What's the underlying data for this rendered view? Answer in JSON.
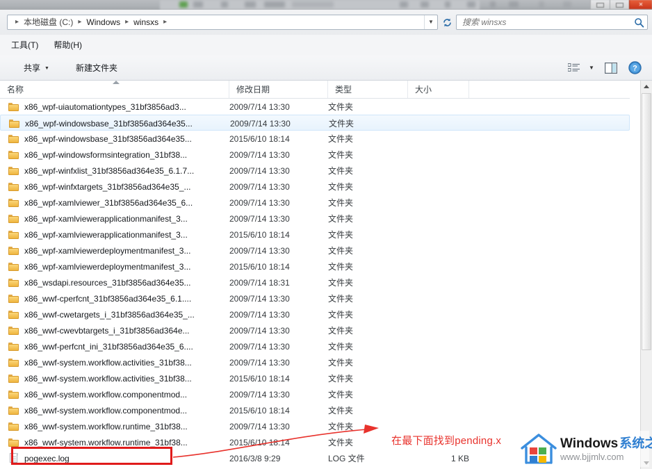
{
  "window": {
    "controls": [
      {
        "name": "minimize",
        "glyph": ""
      },
      {
        "name": "maximize",
        "glyph": ""
      },
      {
        "name": "close",
        "glyph": "✕"
      }
    ]
  },
  "address_bar": {
    "breadcrumbs": [
      "本地磁盘 (C:)",
      "Windows",
      "winsxs"
    ],
    "separator": "▸",
    "dropdown_caret": "▼",
    "refresh_label": "↻",
    "refresh_icon": "refresh-icon"
  },
  "search": {
    "placeholder": "搜索 winsxs",
    "value": "",
    "icon": "search-icon"
  },
  "menu_bar": {
    "items": [
      {
        "label": "工具(T)"
      },
      {
        "label": "帮助(H)"
      }
    ]
  },
  "command_bar": {
    "share_label": "共享",
    "share_caret": "▼",
    "new_folder_label": "新建文件夹",
    "view_icon": "view-mode-icon",
    "view_caret": "▼",
    "preview_icon": "preview-pane-icon",
    "help_icon": "help-icon",
    "help_glyph": "?"
  },
  "columns": [
    {
      "key": "name",
      "label": "名称"
    },
    {
      "key": "date",
      "label": "修改日期"
    },
    {
      "key": "type",
      "label": "类型"
    },
    {
      "key": "size",
      "label": "大小"
    }
  ],
  "sort": {
    "column": "名称",
    "direction": "asc"
  },
  "files": [
    {
      "name": "x86_wpf-uiautomationtypes_31bf3856ad3...",
      "date": "2009/7/14 13:30",
      "type": "文件夹",
      "size": "",
      "icon": "folder-icon",
      "state": "normal"
    },
    {
      "name": "x86_wpf-windowsbase_31bf3856ad364e35...",
      "date": "2009/7/14 13:30",
      "type": "文件夹",
      "size": "",
      "icon": "folder-icon",
      "state": "hover"
    },
    {
      "name": "x86_wpf-windowsbase_31bf3856ad364e35...",
      "date": "2015/6/10 18:14",
      "type": "文件夹",
      "size": "",
      "icon": "folder-icon",
      "state": "normal"
    },
    {
      "name": "x86_wpf-windowsformsintegration_31bf38...",
      "date": "2009/7/14 13:30",
      "type": "文件夹",
      "size": "",
      "icon": "folder-icon",
      "state": "normal"
    },
    {
      "name": "x86_wpf-winfxlist_31bf3856ad364e35_6.1.7...",
      "date": "2009/7/14 13:30",
      "type": "文件夹",
      "size": "",
      "icon": "folder-icon",
      "state": "normal"
    },
    {
      "name": "x86_wpf-winfxtargets_31bf3856ad364e35_...",
      "date": "2009/7/14 13:30",
      "type": "文件夹",
      "size": "",
      "icon": "folder-icon",
      "state": "normal"
    },
    {
      "name": "x86_wpf-xamlviewer_31bf3856ad364e35_6...",
      "date": "2009/7/14 13:30",
      "type": "文件夹",
      "size": "",
      "icon": "folder-icon",
      "state": "normal"
    },
    {
      "name": "x86_wpf-xamlviewerapplicationmanifest_3...",
      "date": "2009/7/14 13:30",
      "type": "文件夹",
      "size": "",
      "icon": "folder-icon",
      "state": "normal"
    },
    {
      "name": "x86_wpf-xamlviewerapplicationmanifest_3...",
      "date": "2015/6/10 18:14",
      "type": "文件夹",
      "size": "",
      "icon": "folder-icon",
      "state": "normal"
    },
    {
      "name": "x86_wpf-xamlviewerdeploymentmanifest_3...",
      "date": "2009/7/14 13:30",
      "type": "文件夹",
      "size": "",
      "icon": "folder-icon",
      "state": "normal"
    },
    {
      "name": "x86_wpf-xamlviewerdeploymentmanifest_3...",
      "date": "2015/6/10 18:14",
      "type": "文件夹",
      "size": "",
      "icon": "folder-icon",
      "state": "normal"
    },
    {
      "name": "x86_wsdapi.resources_31bf3856ad364e35...",
      "date": "2009/7/14 18:31",
      "type": "文件夹",
      "size": "",
      "icon": "folder-icon",
      "state": "normal"
    },
    {
      "name": "x86_wwf-cperfcnt_31bf3856ad364e35_6.1....",
      "date": "2009/7/14 13:30",
      "type": "文件夹",
      "size": "",
      "icon": "folder-icon",
      "state": "normal"
    },
    {
      "name": "x86_wwf-cwetargets_i_31bf3856ad364e35_...",
      "date": "2009/7/14 13:30",
      "type": "文件夹",
      "size": "",
      "icon": "folder-icon",
      "state": "normal"
    },
    {
      "name": "x86_wwf-cwevbtargets_i_31bf3856ad364e...",
      "date": "2009/7/14 13:30",
      "type": "文件夹",
      "size": "",
      "icon": "folder-icon",
      "state": "normal"
    },
    {
      "name": "x86_wwf-perfcnt_ini_31bf3856ad364e35_6....",
      "date": "2009/7/14 13:30",
      "type": "文件夹",
      "size": "",
      "icon": "folder-icon",
      "state": "normal"
    },
    {
      "name": "x86_wwf-system.workflow.activities_31bf38...",
      "date": "2009/7/14 13:30",
      "type": "文件夹",
      "size": "",
      "icon": "folder-icon",
      "state": "normal"
    },
    {
      "name": "x86_wwf-system.workflow.activities_31bf38...",
      "date": "2015/6/10 18:14",
      "type": "文件夹",
      "size": "",
      "icon": "folder-icon",
      "state": "normal"
    },
    {
      "name": "x86_wwf-system.workflow.componentmod...",
      "date": "2009/7/14 13:30",
      "type": "文件夹",
      "size": "",
      "icon": "folder-icon",
      "state": "normal"
    },
    {
      "name": "x86_wwf-system.workflow.componentmod...",
      "date": "2015/6/10 18:14",
      "type": "文件夹",
      "size": "",
      "icon": "folder-icon",
      "state": "normal"
    },
    {
      "name": "x86_wwf-system.workflow.runtime_31bf38...",
      "date": "2009/7/14 13:30",
      "type": "文件夹",
      "size": "",
      "icon": "folder-icon",
      "state": "normal"
    },
    {
      "name": "x86_wwf-system.workflow.runtime_31bf38...",
      "date": "2015/6/10 18:14",
      "type": "文件夹",
      "size": "",
      "icon": "folder-icon",
      "state": "normal"
    },
    {
      "name": "pogexec.log",
      "date": "2016/3/8 9:29",
      "type": "LOG 文件",
      "size": "1 KB",
      "icon": "log-file-icon",
      "state": "normal"
    }
  ],
  "annotation": {
    "text": "在最下面找到pending.x",
    "color": "#e8322c",
    "highlight_target": "pogexec.log"
  },
  "watermark": {
    "brand_en": "Windows",
    "brand_cn": "系统之家",
    "url": "www.bjjmlv.com",
    "logo_icon": "windows-house-logo"
  },
  "scrollbar": {
    "up_arrow": "scroll-up-arrow",
    "down_arrow": "scroll-down-arrow"
  }
}
